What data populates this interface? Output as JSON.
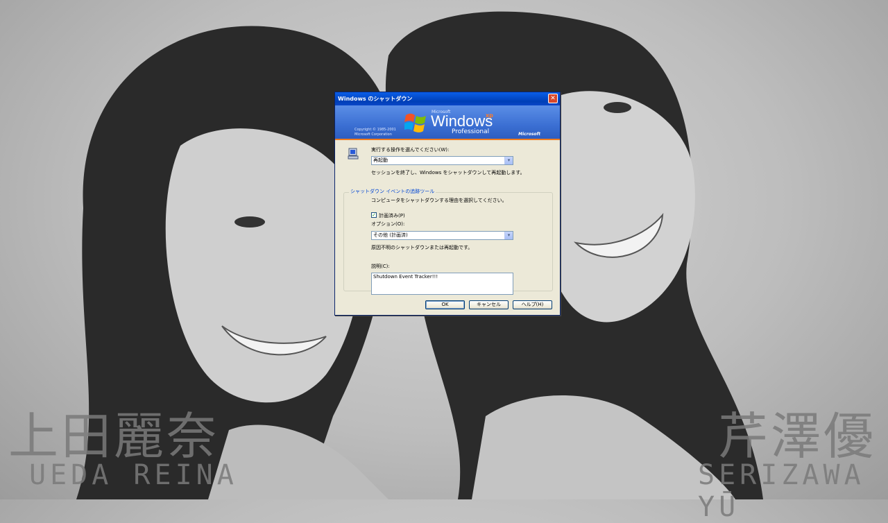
{
  "background": {
    "left_name_kanji": "上田麗奈",
    "left_name_roman": "UEDA REINA",
    "right_name_kanji": "芹澤優",
    "right_name_roman": "SERIZAWA YŪ"
  },
  "dialog": {
    "title": "Windows のシャットダウン",
    "banner": {
      "microsoft_small": "Microsoft",
      "windows": "Windows",
      "version": "xp",
      "edition": "Professional",
      "copyright_line1": "Copyright © 1985-2001",
      "copyright_line2": "Microsoft Corporation",
      "ms_logo": "Microsoft"
    },
    "action_label": "実行する操作を選んでください(W):",
    "action_value": "再起動",
    "action_description": "セッションを終了し、Windows をシャットダウンして再起動します。",
    "group_title": "シャットダウン イベントの追跡ツール",
    "group_description": "コンピュータをシャットダウンする理由を選択してください。",
    "planned_label": "計画済み(P)",
    "planned_checked": true,
    "option_label": "オプション(O):",
    "option_value": "その他 (計画済)",
    "option_description": "原因不明のシャットダウンまたは再起動です。",
    "comment_label": "説明(C):",
    "comment_value": "Shutdown Event Tracker!!!",
    "ok_label": "OK",
    "cancel_label": "キャンセル",
    "help_label": "ヘルプ(H)"
  },
  "colors": {
    "titlebar": "#0a5ee8",
    "dialog_bg": "#ece9d8",
    "group_title": "#0046d5"
  }
}
